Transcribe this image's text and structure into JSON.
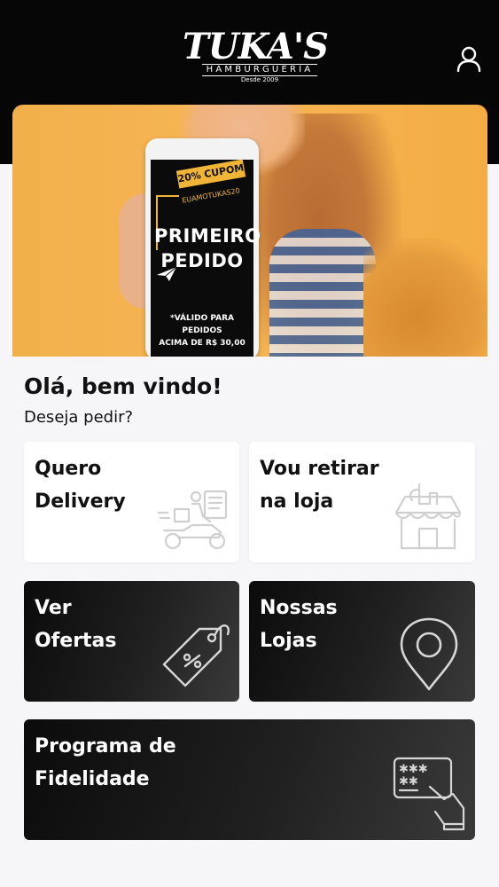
{
  "header": {
    "brand": "TUKA'S",
    "brand_sub": "HAMBURGUERIA",
    "brand_since": "Desde 2009",
    "account_icon": "user-icon"
  },
  "banner": {
    "coupon_tag": "20% CUPOM",
    "coupon_code": "EUAMOTUKAS20",
    "title_line1": "PRIMEIRO",
    "title_line2": "PEDIDO",
    "note_line1": "*VÁLIDO PARA PEDIDOS",
    "note_line2": "ACIMA DE R$ 30,00"
  },
  "welcome": {
    "title": "Olá, bem vindo!",
    "subtitle": "Deseja pedir?"
  },
  "options": {
    "delivery": {
      "line1": "Quero",
      "line2": "Delivery",
      "icon": "delivery-scooter-icon"
    },
    "pickup": {
      "line1": "Vou retirar",
      "line2": "na loja",
      "icon": "store-pickup-icon"
    },
    "offers": {
      "line1": "Ver",
      "line2": "Ofertas",
      "icon": "discount-tag-icon"
    },
    "stores": {
      "line1": "Nossas",
      "line2": "Lojas",
      "icon": "map-pin-icon"
    },
    "loyalty": {
      "line1": "Programa de",
      "line2": "Fidelidade",
      "icon": "loyalty-card-icon"
    }
  },
  "colors": {
    "header_bg": "#060606",
    "page_bg": "#f6f6f8",
    "card_dark": "#0b0b0b",
    "accent_yellow": "#f0b436"
  }
}
